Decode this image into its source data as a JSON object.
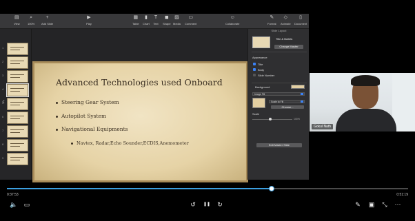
{
  "keynote": {
    "toolbar": [
      {
        "label": "View",
        "icon": "view-icon",
        "glyph": "▤"
      },
      {
        "label": "100%",
        "icon": "zoom-icon",
        "glyph": "⌕"
      },
      {
        "label": "Add Slide",
        "icon": "add-slide-icon",
        "glyph": "+"
      },
      {
        "label": "Play",
        "icon": "play-icon",
        "glyph": "▶"
      },
      {
        "label": "Table",
        "icon": "table-icon",
        "glyph": "▦"
      },
      {
        "label": "Chart",
        "icon": "chart-icon",
        "glyph": "▮"
      },
      {
        "label": "Text",
        "icon": "text-icon",
        "glyph": "T"
      },
      {
        "label": "Shape",
        "icon": "shape-icon",
        "glyph": "◼"
      },
      {
        "label": "Media",
        "icon": "media-icon",
        "glyph": "▨"
      },
      {
        "label": "Comment",
        "icon": "comment-icon",
        "glyph": "▭"
      },
      {
        "label": "Collaborate",
        "icon": "collaborate-icon",
        "glyph": "☺"
      },
      {
        "label": "Format",
        "icon": "format-icon",
        "glyph": "✎"
      },
      {
        "label": "Animate",
        "icon": "animate-icon",
        "glyph": "◇"
      },
      {
        "label": "Document",
        "icon": "document-icon",
        "glyph": "▯"
      }
    ],
    "navigator": {
      "slide_numbers": [
        "1",
        "2",
        "3",
        "4",
        "5",
        "6",
        "7",
        "8",
        "9"
      ]
    },
    "slide": {
      "title": "Advanced Technologies used Onboard",
      "bullets": [
        "Steering Gear System",
        "Autopilot System",
        "Navigational Equipments"
      ],
      "sub_bullets": [
        "Navtex, Radar,Echo Sounder,ECDIS,Anemometer"
      ]
    },
    "inspector": {
      "header": "Slide Layout",
      "layout_name": "Title & Bullets",
      "change_master": "Change Master",
      "appearance_heading": "Appearance",
      "appearance_options": [
        {
          "label": "Title",
          "checked": true
        },
        {
          "label": "Body",
          "checked": true
        },
        {
          "label": "Slide Number",
          "checked": false
        }
      ],
      "background_heading": "Background",
      "background_fill": "Image Fill",
      "scale_mode": "Scale to Fill",
      "choose_button": "Choose...",
      "scale_label": "Scale",
      "scale_value": "100%",
      "edit_master": "Edit Master Slide"
    }
  },
  "video_call": {
    "participant_name": "Gokul Nath"
  },
  "player": {
    "current_time": "0:37:53",
    "total_time": "0:51:19",
    "progress": 0.66,
    "accent_color": "#3b9fe0",
    "controls": [
      {
        "name": "volume-icon",
        "glyph": "🔈"
      },
      {
        "name": "captions-icon",
        "glyph": "▭"
      },
      {
        "name": "rewind-10-icon",
        "glyph": "↺"
      },
      {
        "name": "pause-icon",
        "glyph": "❚❚"
      },
      {
        "name": "forward-10-icon",
        "glyph": "↻"
      },
      {
        "name": "annotate-icon",
        "glyph": "✎"
      },
      {
        "name": "picture-in-picture-icon",
        "glyph": "▣"
      },
      {
        "name": "exit-fullscreen-icon",
        "glyph": "⤡"
      },
      {
        "name": "more-options-icon",
        "glyph": "⋯"
      }
    ]
  }
}
